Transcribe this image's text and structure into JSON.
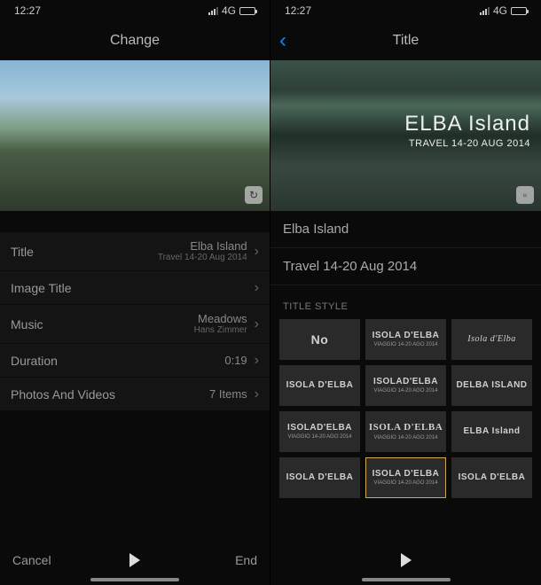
{
  "status": {
    "time": "12:27",
    "network": "4G"
  },
  "left": {
    "nav_title": "Change",
    "settings": {
      "title_label": "Title",
      "title_value": "Elba Island",
      "title_sub": "Travel 14-20 Aug 2014",
      "image_title_label": "Image Title",
      "music_label": "Music",
      "music_value": "Meadows",
      "music_sub": "Hans Zimmer",
      "duration_label": "Duration",
      "duration_value": "0:19",
      "photos_label": "Photos And Videos",
      "photos_value": "7 Items"
    },
    "bottom": {
      "cancel": "Cancel",
      "end": "End"
    }
  },
  "right": {
    "nav_title": "Title",
    "preview": {
      "title_main": "ELBA Island",
      "title_sub": "TRAVEL 14-20 AUG 2014"
    },
    "edit_title": "Elba Island",
    "edit_subtitle": "Travel 14-20 Aug 2014",
    "section_header": "TITLE STYLE",
    "styles": [
      {
        "main": "No",
        "sub": "",
        "cls": "big"
      },
      {
        "main": "ISOLA D'ELBA",
        "sub": "VIAGGIO 14-20 AGO 2014",
        "cls": ""
      },
      {
        "main": "Isola d'Elba",
        "sub": "",
        "cls": "italic"
      },
      {
        "main": "ISOLA D'ELBA",
        "sub": "",
        "cls": ""
      },
      {
        "main": "ISOLAD'ELBA",
        "sub": "VIAGGIO 14-20 AGO 2014",
        "cls": ""
      },
      {
        "main": "DELBA ISLAND",
        "sub": "",
        "cls": ""
      },
      {
        "main": "ISOLAD'ELBA",
        "sub": "VIAGGIO 14-20 AGO 2014",
        "cls": ""
      },
      {
        "main": "ISOLA D'ELBA",
        "sub": "VIAGGIO 14-20 AGO 2014",
        "cls": "serif"
      },
      {
        "main": "ELBA Island",
        "sub": "",
        "cls": ""
      },
      {
        "main": "ISOLA D'ELBA",
        "sub": "",
        "cls": ""
      },
      {
        "main": "ISOLA D'ELBA",
        "sub": "VIAGGIO 14-20 AGO 2014",
        "cls": "selected"
      },
      {
        "main": "ISOLA D'ELBA",
        "sub": "",
        "cls": ""
      }
    ]
  }
}
